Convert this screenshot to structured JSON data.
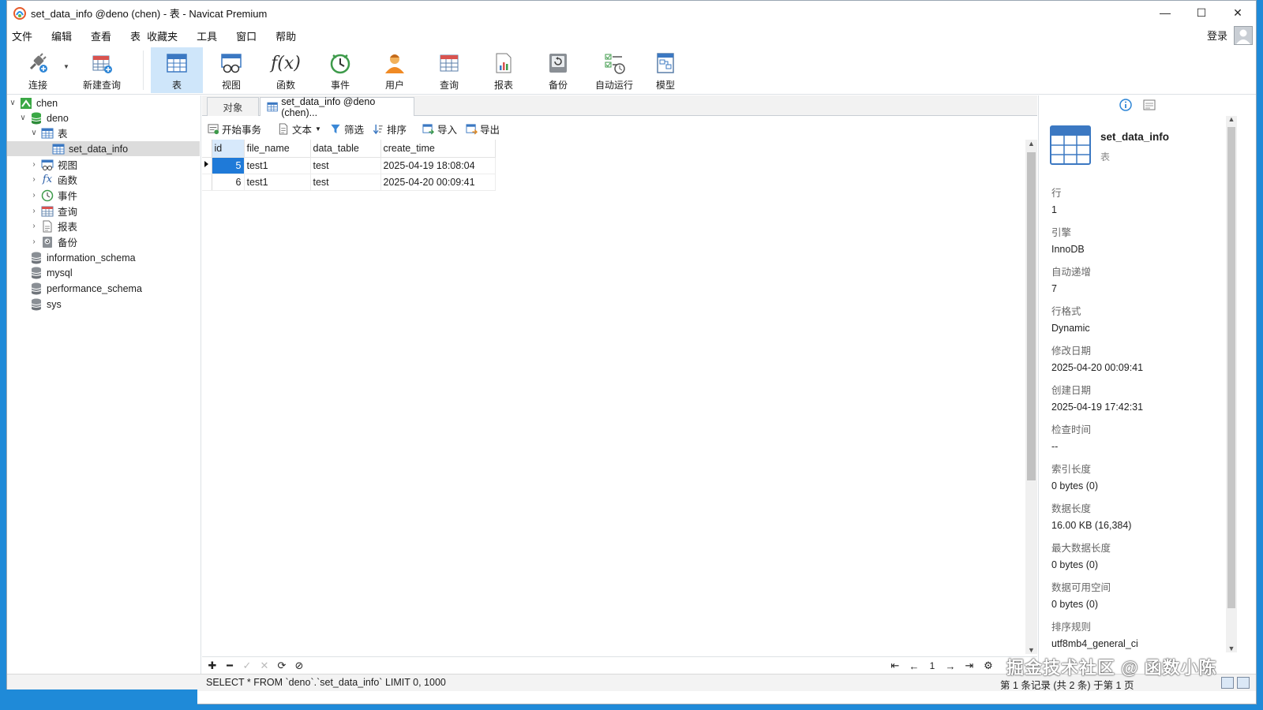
{
  "window": {
    "title": "set_data_info @deno (chen) - 表 - Navicat Premium"
  },
  "window_controls": {
    "minimize": "—",
    "maximize": "☐",
    "close": "✕"
  },
  "menu": [
    "文件",
    "编辑",
    "查看",
    "表",
    "收藏夹",
    "工具",
    "窗口",
    "帮助"
  ],
  "login_label": "登录",
  "toolbar": [
    {
      "label": "连接",
      "icon": "plug-icon"
    },
    {
      "label": "新建查询",
      "icon": "new-query-icon"
    },
    {
      "label": "表",
      "icon": "table-icon",
      "active": true
    },
    {
      "label": "视图",
      "icon": "view-icon"
    },
    {
      "label": "函数",
      "icon": "function-icon"
    },
    {
      "label": "事件",
      "icon": "clock-icon"
    },
    {
      "label": "用户",
      "icon": "user-icon"
    },
    {
      "label": "查询",
      "icon": "query-icon"
    },
    {
      "label": "报表",
      "icon": "report-icon"
    },
    {
      "label": "备份",
      "icon": "backup-icon"
    },
    {
      "label": "自动运行",
      "icon": "autorun-icon"
    },
    {
      "label": "模型",
      "icon": "model-icon"
    }
  ],
  "tree": [
    {
      "label": "chen",
      "level": 0,
      "expanded": true,
      "icon": "connection-icon"
    },
    {
      "label": "deno",
      "level": 1,
      "expanded": true,
      "icon": "database-green-icon"
    },
    {
      "label": "表",
      "level": 2,
      "expanded": true,
      "icon": "table-folder-icon"
    },
    {
      "label": "set_data_info",
      "level": 3,
      "selected": true,
      "icon": "table-icon"
    },
    {
      "label": "视图",
      "level": 2,
      "collapsed": true,
      "icon": "view-icon"
    },
    {
      "label": "函数",
      "level": 2,
      "collapsed": true,
      "icon": "function-icon"
    },
    {
      "label": "事件",
      "level": 2,
      "collapsed": true,
      "icon": "clock-icon"
    },
    {
      "label": "查询",
      "level": 2,
      "collapsed": true,
      "icon": "query-icon"
    },
    {
      "label": "报表",
      "level": 2,
      "collapsed": true,
      "icon": "report-icon"
    },
    {
      "label": "备份",
      "level": 2,
      "collapsed": true,
      "icon": "backup-icon"
    },
    {
      "label": "information_schema",
      "level": 1,
      "icon": "database-gray-icon"
    },
    {
      "label": "mysql",
      "level": 1,
      "icon": "database-gray-icon"
    },
    {
      "label": "performance_schema",
      "level": 1,
      "icon": "database-gray-icon"
    },
    {
      "label": "sys",
      "level": 1,
      "icon": "database-gray-icon"
    }
  ],
  "tabs": {
    "objects": "对象",
    "active": "set_data_info @deno (chen)..."
  },
  "subtoolbar": {
    "begin_transaction": "开始事务",
    "text": "文本",
    "filter": "筛选",
    "sort": "排序",
    "import": "导入",
    "export": "导出"
  },
  "grid": {
    "columns": [
      "id",
      "file_name",
      "data_table",
      "create_time"
    ],
    "rows": [
      [
        "5",
        "test1",
        "test",
        "2025-04-19 18:08:04"
      ],
      [
        "6",
        "test1",
        "test",
        "2025-04-20 00:09:41"
      ]
    ]
  },
  "bottombar": {
    "page": "1"
  },
  "status": {
    "sql": "SELECT * FROM `deno`.`set_data_info` LIMIT 0, 1000",
    "count": "第 1 条记录 (共 2 条) 于第 1 页"
  },
  "info": {
    "name": "set_data_info",
    "type": "表",
    "props": [
      {
        "label": "行",
        "value": "1"
      },
      {
        "label": "引擎",
        "value": "InnoDB"
      },
      {
        "label": "自动递增",
        "value": "7"
      },
      {
        "label": "行格式",
        "value": "Dynamic"
      },
      {
        "label": "修改日期",
        "value": "2025-04-20 00:09:41"
      },
      {
        "label": "创建日期",
        "value": "2025-04-19 17:42:31"
      },
      {
        "label": "检查时间",
        "value": "--"
      },
      {
        "label": "索引长度",
        "value": "0 bytes (0)"
      },
      {
        "label": "数据长度",
        "value": "16.00 KB (16,384)"
      },
      {
        "label": "最大数据长度",
        "value": "0 bytes (0)"
      },
      {
        "label": "数据可用空间",
        "value": "0 bytes (0)"
      },
      {
        "label": "排序规则",
        "value": "utf8mb4_general_ci"
      }
    ]
  },
  "watermark": "掘金技术社区 @ 函数小陈",
  "colors": {
    "accent": "#1f7ad8",
    "active_tab": "#cfe6fa",
    "db_green": "#3aa845"
  }
}
